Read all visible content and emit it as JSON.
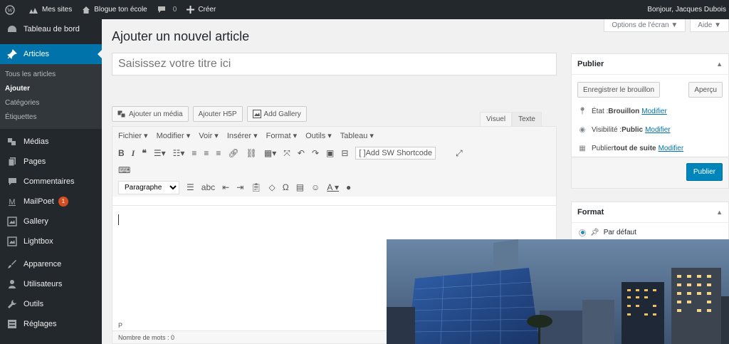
{
  "adminbar": {
    "sites_label": "Mes sites",
    "site_name": "Blogue ton école",
    "comments_count": "0",
    "new_label": "Créer",
    "greeting": "Bonjour, Jacques Dubois"
  },
  "sidebar": {
    "dashboard": "Tableau de bord",
    "articles": "Articles",
    "submenu": [
      "Tous les articles",
      "Ajouter",
      "Catégories",
      "Étiquettes"
    ],
    "items": [
      {
        "label": "Médias",
        "icon": "media-icon"
      },
      {
        "label": "Pages",
        "icon": "pages-icon"
      },
      {
        "label": "Commentaires",
        "icon": "comments-icon"
      },
      {
        "label": "MailPoet",
        "icon": "mailpoet-icon",
        "badge": "1"
      },
      {
        "label": "Gallery",
        "icon": "gallery-icon"
      },
      {
        "label": "Lightbox",
        "icon": "lightbox-icon"
      },
      {
        "label": "Apparence",
        "icon": "appearance-icon"
      },
      {
        "label": "Utilisateurs",
        "icon": "users-icon"
      },
      {
        "label": "Outils",
        "icon": "tools-icon"
      },
      {
        "label": "Réglages",
        "icon": "settings-icon"
      }
    ]
  },
  "main": {
    "title": "Ajouter un nouvel article",
    "screen_options": "Options de l'écran ▼",
    "help": "Aide ▼",
    "title_placeholder": "Saisissez votre titre ici",
    "add_media": "Ajouter un média",
    "add_h5p": "Ajouter H5P",
    "add_gallery": "Add Gallery",
    "tab_visual": "Visuel",
    "tab_text": "Texte",
    "menus": [
      "Fichier ▾",
      "Modifier ▾",
      "Voir ▾",
      "Insérer ▾",
      "Format ▾",
      "Outils ▾",
      "Tableau ▾"
    ],
    "shortcode_label": "Add SW Shortcode",
    "paragraph": "Paragraphe",
    "path": "P",
    "word_count": "Nombre de mots : 0"
  },
  "publish": {
    "title": "Publier",
    "save_draft": "Enregistrer le brouillon",
    "preview": "Aperçu",
    "status_label": "État : ",
    "status_value": "Brouillon",
    "visibility_label": "Visibilité : ",
    "visibility_value": "Public",
    "publish_when_label": "Publier ",
    "publish_when_value": "tout de suite",
    "modify": "Modifier",
    "publish_button": "Publier"
  },
  "format": {
    "title": "Format",
    "default": "Par défaut"
  },
  "colors": {
    "adminbar": "#23282d",
    "accent": "#0073aa",
    "publish": "#0085ba"
  }
}
